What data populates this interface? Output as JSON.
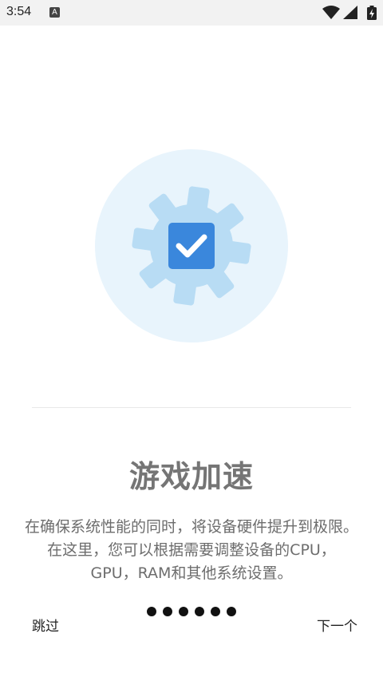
{
  "status_bar": {
    "time": "3:54",
    "notification_icon_letter": "A",
    "icons": [
      "wifi-icon",
      "signal-icon",
      "battery-charging-icon"
    ]
  },
  "hero": {
    "icon": "gear-checkmark-icon",
    "colors": {
      "circle": "#e8f4fc",
      "gear": "#b8dcf4",
      "checkbox": "#3a87dc",
      "check": "#ffffff"
    }
  },
  "onboarding": {
    "title": "游戏加速",
    "description": "在确保系统性能的同时，将设备硬件提升到极限。在这里，您可以根据需要调整设备的CPU，GPU，RAM和其他系统设置。",
    "page_count": 6
  },
  "navigation": {
    "skip_label": "跳过",
    "next_label": "下一个"
  }
}
